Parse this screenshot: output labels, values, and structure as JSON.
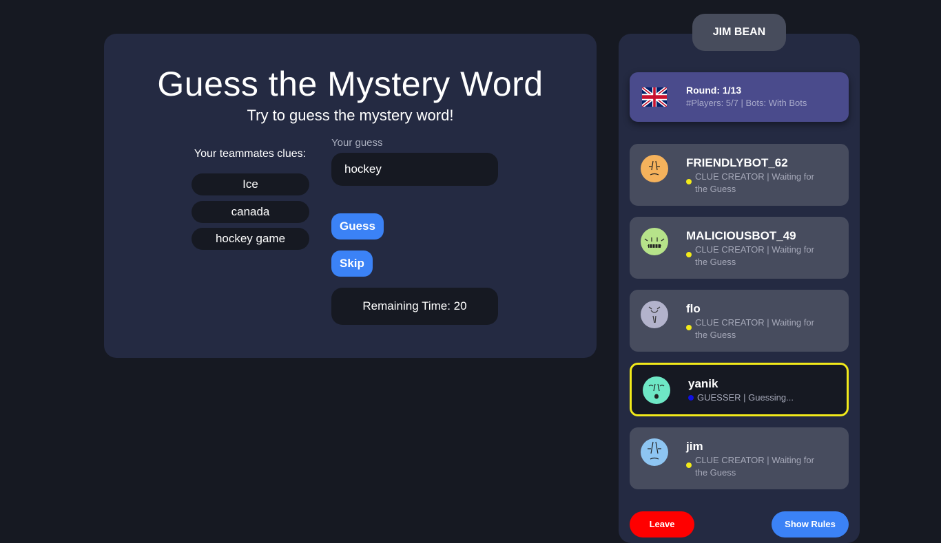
{
  "main": {
    "title": "Guess the Mystery Word",
    "subtitle": "Try to guess the mystery word!",
    "clues_label": "Your teammates clues:",
    "clues": [
      "Ice",
      "canada",
      "hockey game"
    ],
    "guess_label": "Your guess",
    "guess_value": "hockey",
    "guess_button": "Guess",
    "skip_button": "Skip",
    "remaining_time": "Remaining Time: 20"
  },
  "sidebar": {
    "user_name": "JIM BEAN",
    "round": {
      "title": "Round: 1/13",
      "info": "#Players: 5/7 | Bots: With Bots",
      "flag_icon": "uk-flag-icon"
    },
    "players": [
      {
        "name": "FRIENDLYBOT_62",
        "status": "CLUE CREATOR | Waiting for the Guess",
        "avatar_color": "#f5b25c",
        "dot_color": "#f2ea1a",
        "active": false
      },
      {
        "name": "MALICIOUSBOT_49",
        "status": "CLUE CREATOR | Waiting for the Guess",
        "avatar_color": "#b6e38a",
        "dot_color": "#f2ea1a",
        "active": false
      },
      {
        "name": "flo",
        "status": "CLUE CREATOR | Waiting for the Guess",
        "avatar_color": "#b3b3cc",
        "dot_color": "#f2ea1a",
        "active": false
      },
      {
        "name": "yanik",
        "status": "GUESSER | Guessing...",
        "avatar_color": "#6ee7c5",
        "dot_color": "#1010e0",
        "active": true
      },
      {
        "name": "jim",
        "status": "CLUE CREATOR | Waiting for the Guess",
        "avatar_color": "#8ec5f2",
        "dot_color": "#f2ea1a",
        "active": false
      }
    ],
    "leave_button": "Leave",
    "rules_button": "Show Rules"
  },
  "colors": {
    "background": "#161922",
    "panel": "#242a42",
    "accent": "#3b82f6",
    "danger": "#ff0000",
    "active_border": "#f2ea1a"
  }
}
